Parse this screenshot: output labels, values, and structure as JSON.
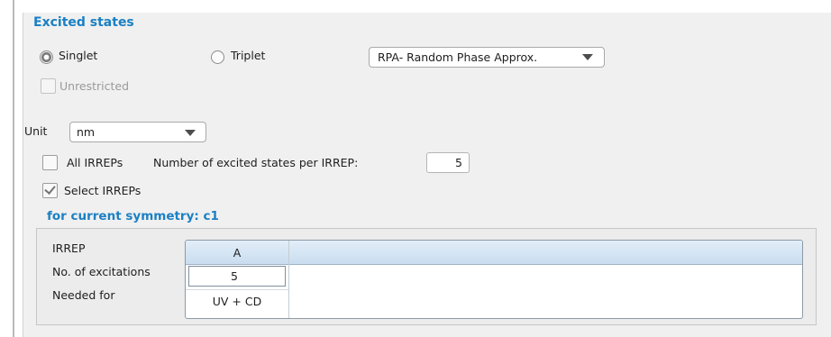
{
  "section": {
    "title": "Excited states"
  },
  "spin": {
    "singlet_label": "Singlet",
    "triplet_label": "Triplet",
    "selected": "Singlet",
    "method_selected": "RPA- Random Phase Approx."
  },
  "unrestricted": {
    "label": "Unrestricted",
    "checked": false,
    "enabled": false
  },
  "unit": {
    "label": "Unit",
    "selected": "nm"
  },
  "all_irreps": {
    "label": "All IRREPs",
    "checked": false
  },
  "states_per_irrep": {
    "label": "Number of excited states per IRREP:",
    "value": "5"
  },
  "select_irreps": {
    "label": "Select IRREPs",
    "checked": true
  },
  "symmetry": {
    "title": "for current symmetry: c1"
  },
  "irrep_table": {
    "row_labels": [
      "IRREP",
      "No. of excitations",
      "Needed for"
    ],
    "columns": [
      {
        "irrep": "A",
        "excitations": "5",
        "needed_for": "UV + CD"
      }
    ]
  }
}
